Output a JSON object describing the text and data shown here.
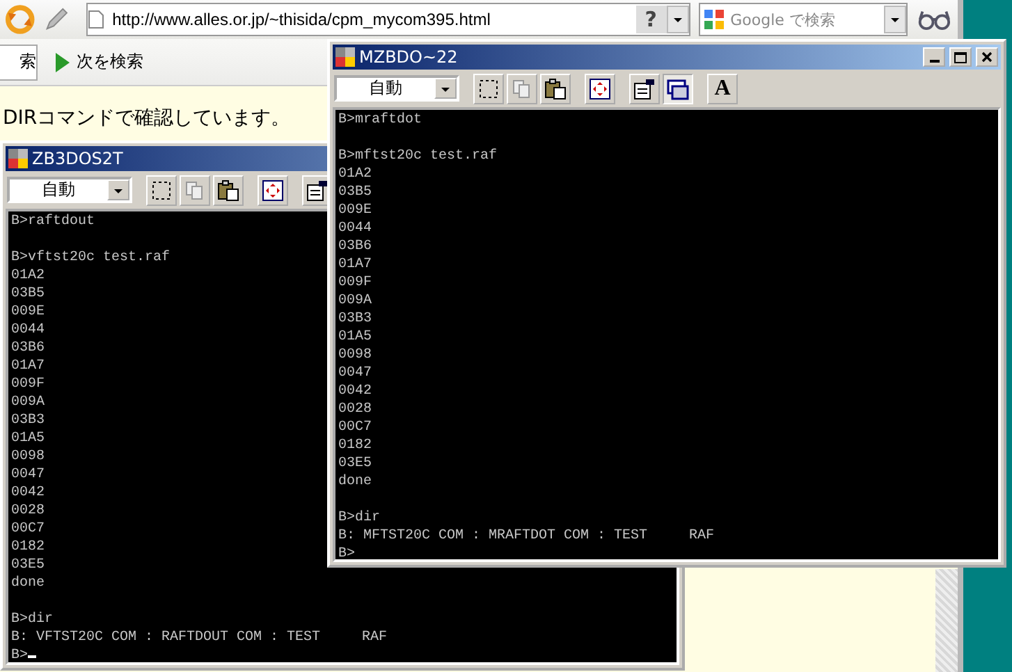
{
  "browser": {
    "address": "http://www.alles.or.jp/~thisida/cpm_mycom395.html",
    "help_button": "?",
    "search_placeholder": "Google で検索",
    "find_field": "索",
    "find_next": "次を検索",
    "page_text": "DIRコマンドで確認しています。"
  },
  "windows": [
    {
      "title": "ZB3DOS2T",
      "controls": false,
      "cursor": true,
      "font_select": "自動",
      "tools": [
        {
          "kind": "select",
          "on": false
        },
        {
          "kind": "copy",
          "on": false
        },
        {
          "kind": "paste",
          "on": false
        },
        {
          "kind": "fullscreen",
          "on": false
        },
        {
          "kind": "properties",
          "on": false
        }
      ],
      "blocks": [
        [
          "B>raftdout"
        ],
        [
          "B>vftst20c test.raf",
          "01A2",
          "03B5",
          "009E",
          "0044",
          "03B6",
          "01A7",
          "009F",
          "009A",
          "03B3",
          "01A5",
          "0098",
          "0047",
          "0042",
          "0028",
          "00C7",
          "0182",
          "03E5",
          "done"
        ],
        [
          "B>dir",
          "B: VFTST20C COM : RAFTDOUT COM : TEST     RAF",
          "B>"
        ]
      ]
    },
    {
      "title": "MZBDO~22",
      "controls": true,
      "cursor": false,
      "font_select": "自動",
      "tools": [
        {
          "kind": "select",
          "on": false
        },
        {
          "kind": "copy",
          "on": false
        },
        {
          "kind": "paste",
          "on": false
        },
        {
          "kind": "fullscreen",
          "on": false
        },
        {
          "kind": "properties",
          "on": false
        },
        {
          "kind": "window",
          "on": true
        },
        {
          "kind": "font",
          "on": false,
          "label": "A"
        }
      ],
      "blocks": [
        [
          "B>mraftdot"
        ],
        [
          "B>mftst20c test.raf",
          "01A2",
          "03B5",
          "009E",
          "0044",
          "03B6",
          "01A7",
          "009F",
          "009A",
          "03B3",
          "01A5",
          "0098",
          "0047",
          "0042",
          "0028",
          "00C7",
          "0182",
          "03E5",
          "done"
        ],
        [
          "B>dir",
          "B: MFTST20C COM : MRAFTDOT COM : TEST     RAF",
          "B>"
        ]
      ]
    }
  ]
}
